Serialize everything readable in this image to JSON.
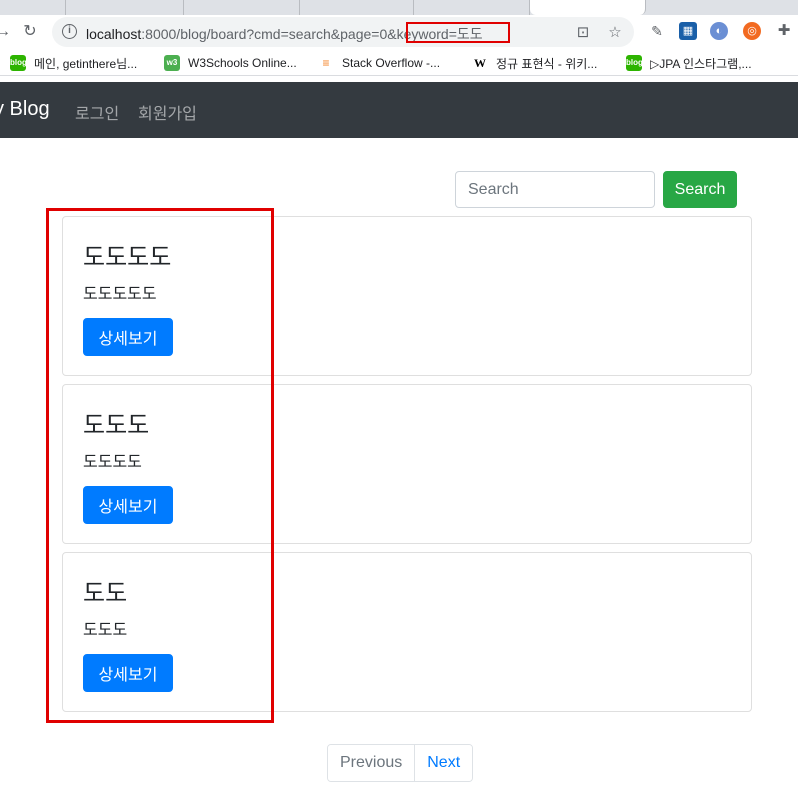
{
  "browser": {
    "url_host": "localhost",
    "url_rest": ":8000/blog/board?cmd=search&page=0&keyword=도도",
    "bookmarks": [
      {
        "label": "메인, getinthere님...",
        "icon": "blog-icon",
        "color": "#2db400"
      },
      {
        "label": "W3Schools Online...",
        "icon": "w3schools-icon",
        "color": "#4caf50"
      },
      {
        "label": "Stack Overflow -...",
        "icon": "stackoverflow-icon",
        "color": "#f48024"
      },
      {
        "label": "정규 표현식 - 위키...",
        "icon": "wikipedia-icon",
        "color": "#000000"
      },
      {
        "label": "▷JPA 인스타그램,...",
        "icon": "blog-icon",
        "color": "#2db400"
      }
    ]
  },
  "navbar": {
    "brand": "y Blog",
    "links": [
      "로그인",
      "회원가입"
    ]
  },
  "search": {
    "placeholder": "Search",
    "button_label": "Search"
  },
  "posts": [
    {
      "title": "도도도도",
      "content": "도도도도도",
      "button_label": "상세보기"
    },
    {
      "title": "도도도",
      "content": "도도도도",
      "button_label": "상세보기"
    },
    {
      "title": "도도",
      "content": "도도도",
      "button_label": "상세보기"
    }
  ],
  "pagination": {
    "previous": "Previous",
    "next": "Next"
  },
  "colors": {
    "navbar_bg": "#343a40",
    "primary": "#007bff",
    "success": "#28a745",
    "annotation_red": "#e00000"
  }
}
